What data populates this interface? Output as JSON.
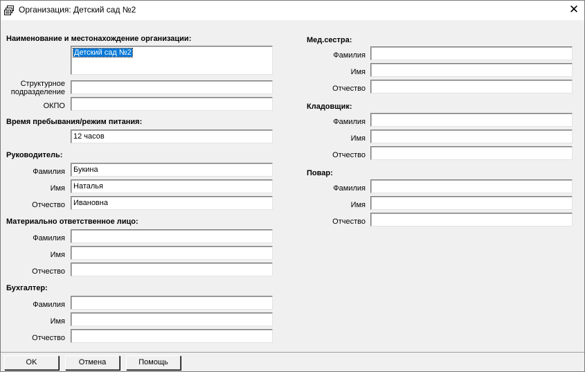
{
  "window": {
    "title": "Организация: Детский сад №2",
    "close_glyph": "✕"
  },
  "org": {
    "section": "Наименование и местонахождение организации:",
    "name_value": "Детский сад №2",
    "struct_label_line1": "Структурное",
    "struct_label_line2": "подразделение",
    "struct_value": "",
    "okpo_label": "ОКПО",
    "okpo_value": ""
  },
  "stay": {
    "section": "Время пребывания/режим питания:",
    "value": "12 часов"
  },
  "head": {
    "section": "Руководитель:",
    "surname_label": "Фамилия",
    "surname": "Букина",
    "name_label": "Имя",
    "name": "Наталья",
    "patronymic_label": "Отчество",
    "patronymic": "Ивановна"
  },
  "mat": {
    "section": "Материально ответственное лицо:",
    "surname_label": "Фамилия",
    "surname": "",
    "name_label": "Имя",
    "name": "",
    "patronymic_label": "Отчество",
    "patronymic": ""
  },
  "acc": {
    "section": "Бухгалтер:",
    "surname_label": "Фамилия",
    "surname": "",
    "name_label": "Имя",
    "name": "",
    "patronymic_label": "Отчество",
    "patronymic": ""
  },
  "nurse": {
    "section": "Мед.сестра:",
    "surname_label": "Фамилия",
    "surname": "",
    "name_label": "Имя",
    "name": "",
    "patronymic_label": "Отчество",
    "patronymic": ""
  },
  "store": {
    "section": "Кладовщик:",
    "surname_label": "Фамилия",
    "surname": "",
    "name_label": "Имя",
    "name": "",
    "patronymic_label": "Отчество",
    "patronymic": ""
  },
  "cook": {
    "section": "Повар:",
    "surname_label": "Фамилия",
    "surname": "",
    "name_label": "Имя",
    "name": "",
    "patronymic_label": "Отчество",
    "patronymic": ""
  },
  "buttons": {
    "ok": "OK",
    "cancel": "Отмена",
    "help": "Помощь"
  }
}
